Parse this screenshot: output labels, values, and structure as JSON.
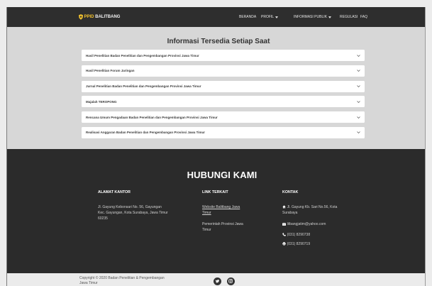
{
  "navbar": {
    "brand_prefix": "PPID",
    "brand_name": "BALITBANG",
    "logo_icon": "emblem-icon",
    "items": [
      {
        "label": "BERANDA",
        "dropdown": false
      },
      {
        "label": "PROFIL",
        "dropdown": true
      },
      {
        "label": "INFORMASI PUBLIK",
        "dropdown": true
      },
      {
        "label": "REGULASI",
        "dropdown": false
      },
      {
        "label": "FAQ",
        "dropdown": false
      }
    ]
  },
  "main": {
    "title": "Informasi Tersedia Setiap Saat",
    "accordion": [
      {
        "label": "Hasil Penelitian Badan Penelitian dan Pengembangan Provinsi Jawa Timur",
        "expanded": false
      },
      {
        "label": "Hasil Penelitian Forum Jaringan",
        "expanded": false
      },
      {
        "label": "Jurnal Penelitian Badan Penelitian dan Pengembangan Provinsi Jawa Timur",
        "expanded": false
      },
      {
        "label": "Majalah TEROPONG",
        "expanded": false
      },
      {
        "label": "Rencana Umum Pengadaan Badan Penelitian dan Pengembangan Provinsi Jawa Timur",
        "expanded": false
      },
      {
        "label": "Realisasi Anggaran Badan Penelitian dan Pengembangan Provinsi Jawa Timur",
        "expanded": false
      }
    ]
  },
  "footer": {
    "title": "HUBUNGI KAMI",
    "address": {
      "heading": "ALAMAT KANTOR",
      "lines": [
        "Jl. Gayung Kebonsari No. 56, Gayungan",
        "Kec. Gayungan, Kota Surabaya, Jawa Timur",
        "60235"
      ]
    },
    "links": {
      "heading": "LINK TERKAIT",
      "items": [
        "Website Balitbang Jawa Timur",
        "Pemerintah Provinsi Jawa Timur"
      ]
    },
    "contact": {
      "heading": "KONTAK",
      "address": "Jl. Gayung Kb. Sari No.56, Kota Surabaya",
      "email": "litbangjatim@yahoo.com",
      "phone": "(031) 8290738",
      "fax": "(031) 8290719",
      "icons": [
        "home-icon",
        "envelope-icon",
        "phone-icon",
        "fax-icon"
      ]
    }
  },
  "bottom_bar": {
    "copyright": "Copyright © 2020 Badan Penelitian & Pengembangan Jawa Timur",
    "social_icons": [
      "twitter-icon",
      "instagram-icon"
    ]
  },
  "colors": {
    "navbar_bg": "#2e2e2e",
    "brand_accent": "#f0c02e",
    "main_bg": "#d7d7d7",
    "panel_bg": "#ffffff",
    "footer_bg": "#2b2b2b",
    "bottom_bg": "#ebebeb",
    "social_bg": "#333333"
  }
}
